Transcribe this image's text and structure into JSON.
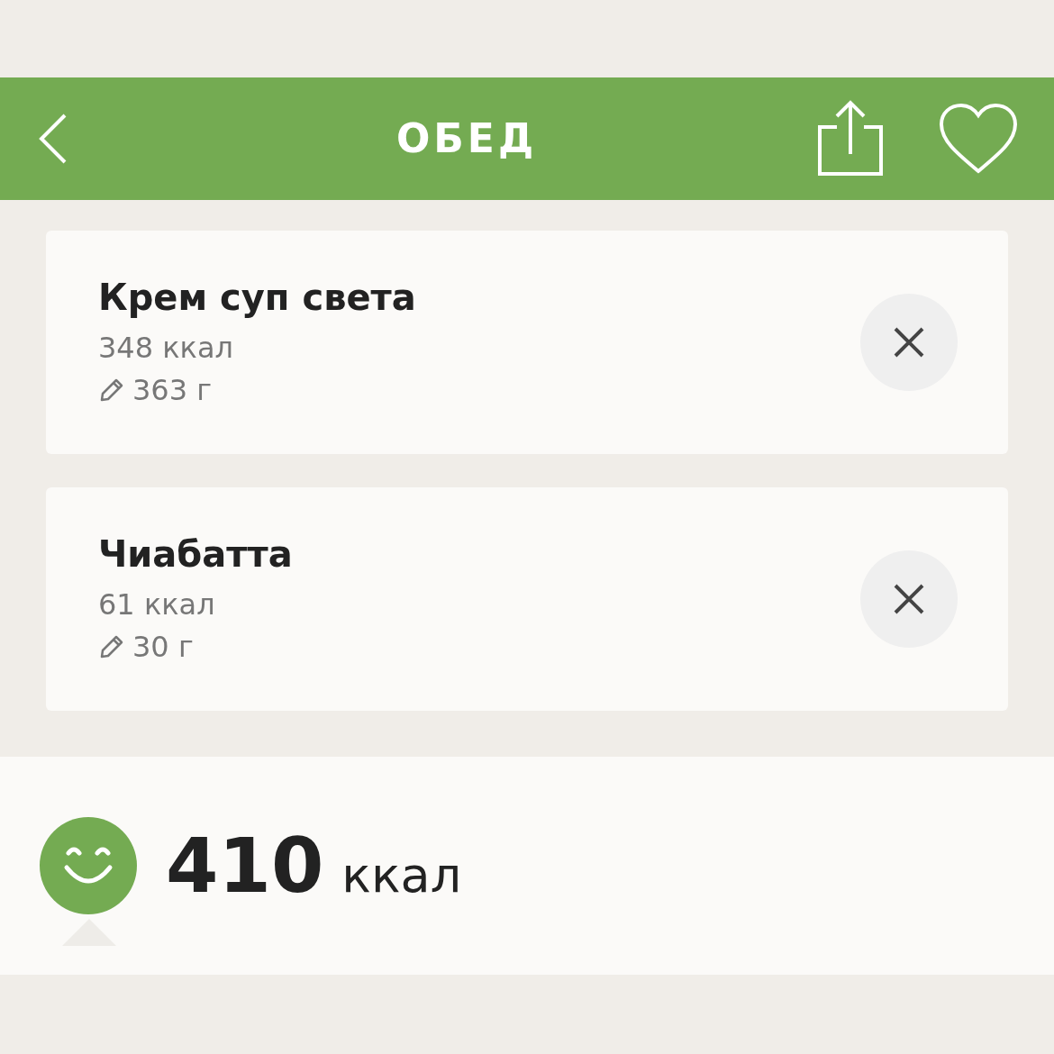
{
  "header": {
    "title": "ОБЕД"
  },
  "items": [
    {
      "name": "Крем суп света",
      "calories": "348 ккал",
      "weight": "363 г"
    },
    {
      "name": "Чиабатта",
      "calories": "61 ккал",
      "weight": "30 г"
    }
  ],
  "total": {
    "value": "410",
    "unit": "ккал"
  }
}
